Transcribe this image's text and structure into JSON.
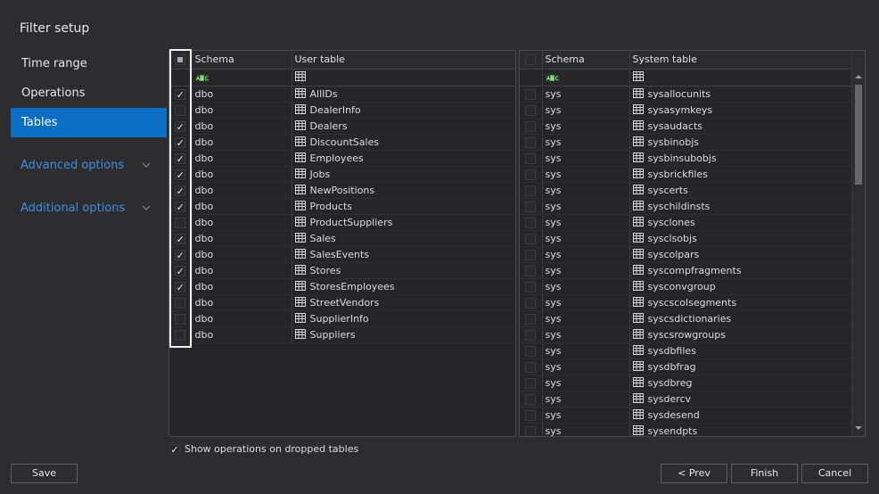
{
  "title": "Filter setup",
  "nav": [
    {
      "label": "Time range"
    },
    {
      "label": "Operations"
    },
    {
      "label": "Tables"
    }
  ],
  "links": {
    "advanced": "Advanced options",
    "additional": "Additional options"
  },
  "user_grid": {
    "col_schema": "Schema",
    "col_table": "User table",
    "filter_icon": "abc-filter-icon",
    "rows": [
      {
        "checked": true,
        "schema": "dbo",
        "table": "AllIDs"
      },
      {
        "checked": false,
        "schema": "dbo",
        "table": "DealerInfo"
      },
      {
        "checked": true,
        "schema": "dbo",
        "table": "Dealers"
      },
      {
        "checked": true,
        "schema": "dbo",
        "table": "DiscountSales"
      },
      {
        "checked": true,
        "schema": "dbo",
        "table": "Employees"
      },
      {
        "checked": true,
        "schema": "dbo",
        "table": "Jobs"
      },
      {
        "checked": true,
        "schema": "dbo",
        "table": "NewPositions"
      },
      {
        "checked": true,
        "schema": "dbo",
        "table": "Products"
      },
      {
        "checked": false,
        "schema": "dbo",
        "table": "ProductSuppliers"
      },
      {
        "checked": true,
        "schema": "dbo",
        "table": "Sales"
      },
      {
        "checked": true,
        "schema": "dbo",
        "table": "SalesEvents"
      },
      {
        "checked": true,
        "schema": "dbo",
        "table": "Stores"
      },
      {
        "checked": true,
        "schema": "dbo",
        "table": "StoresEmployees"
      },
      {
        "checked": false,
        "schema": "dbo",
        "table": "StreetVendors"
      },
      {
        "checked": false,
        "schema": "dbo",
        "table": "SupplierInfo"
      },
      {
        "checked": false,
        "schema": "dbo",
        "table": "Suppliers"
      }
    ]
  },
  "system_grid": {
    "col_schema": "Schema",
    "col_table": "System table",
    "rows": [
      {
        "checked": false,
        "schema": "sys",
        "table": "sysallocunits"
      },
      {
        "checked": false,
        "schema": "sys",
        "table": "sysasymkeys"
      },
      {
        "checked": false,
        "schema": "sys",
        "table": "sysaudacts"
      },
      {
        "checked": false,
        "schema": "sys",
        "table": "sysbinobjs"
      },
      {
        "checked": false,
        "schema": "sys",
        "table": "sysbinsubobjs"
      },
      {
        "checked": false,
        "schema": "sys",
        "table": "sysbrickfiles"
      },
      {
        "checked": false,
        "schema": "sys",
        "table": "syscerts"
      },
      {
        "checked": false,
        "schema": "sys",
        "table": "syschildinsts"
      },
      {
        "checked": false,
        "schema": "sys",
        "table": "sysclones"
      },
      {
        "checked": false,
        "schema": "sys",
        "table": "sysclsobjs"
      },
      {
        "checked": false,
        "schema": "sys",
        "table": "syscolpars"
      },
      {
        "checked": false,
        "schema": "sys",
        "table": "syscompfragments"
      },
      {
        "checked": false,
        "schema": "sys",
        "table": "sysconvgroup"
      },
      {
        "checked": false,
        "schema": "sys",
        "table": "syscscolsegments"
      },
      {
        "checked": false,
        "schema": "sys",
        "table": "syscsdictionaries"
      },
      {
        "checked": false,
        "schema": "sys",
        "table": "syscsrowgroups"
      },
      {
        "checked": false,
        "schema": "sys",
        "table": "sysdbfiles"
      },
      {
        "checked": false,
        "schema": "sys",
        "table": "sysdbfrag"
      },
      {
        "checked": false,
        "schema": "sys",
        "table": "sysdbreg"
      },
      {
        "checked": false,
        "schema": "sys",
        "table": "sysdercv"
      },
      {
        "checked": false,
        "schema": "sys",
        "table": "sysdesend"
      },
      {
        "checked": false,
        "schema": "sys",
        "table": "sysendpts"
      }
    ]
  },
  "show_dropped": {
    "checked": true,
    "label": "Show operations on dropped tables"
  },
  "buttons": {
    "save": "Save",
    "prev": "< Prev",
    "finish": "Finish",
    "cancel": "Cancel"
  },
  "colors": {
    "accent": "#0a6fc4",
    "link": "#3d8fe0",
    "background": "#2d2d30"
  }
}
